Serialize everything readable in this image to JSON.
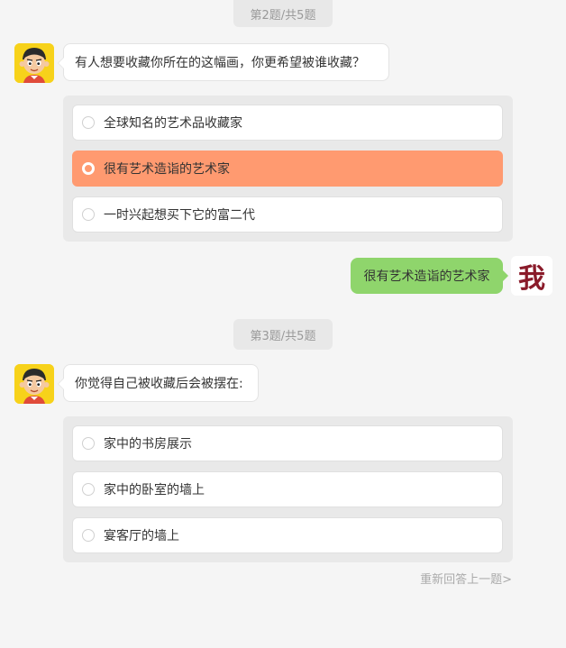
{
  "questions": [
    {
      "progress": "第2题/共5题",
      "text": "有人想要收藏你所在的这幅画，你更希望被谁收藏？",
      "options": [
        "全球知名的艺术品收藏家",
        "很有艺术造诣的艺术家",
        "一时兴起想买下它的富二代"
      ],
      "selected_index": 1
    },
    {
      "progress": "第3题/共5题",
      "text": "你觉得自己被收藏后会被摆在:",
      "options": [
        "家中的书房展示",
        "家中的卧室的墙上",
        "宴客厅的墙上"
      ],
      "selected_index": null
    }
  ],
  "user_answer": "很有艺术造诣的艺术家",
  "me_avatar_text": "我",
  "redo_link": "重新回答上一题>",
  "colors": {
    "background": "#f5f5f5",
    "selected_option": "#ff9a70",
    "answer_bubble": "#8fd56c",
    "me_avatar_text": "#8a1b2a"
  }
}
